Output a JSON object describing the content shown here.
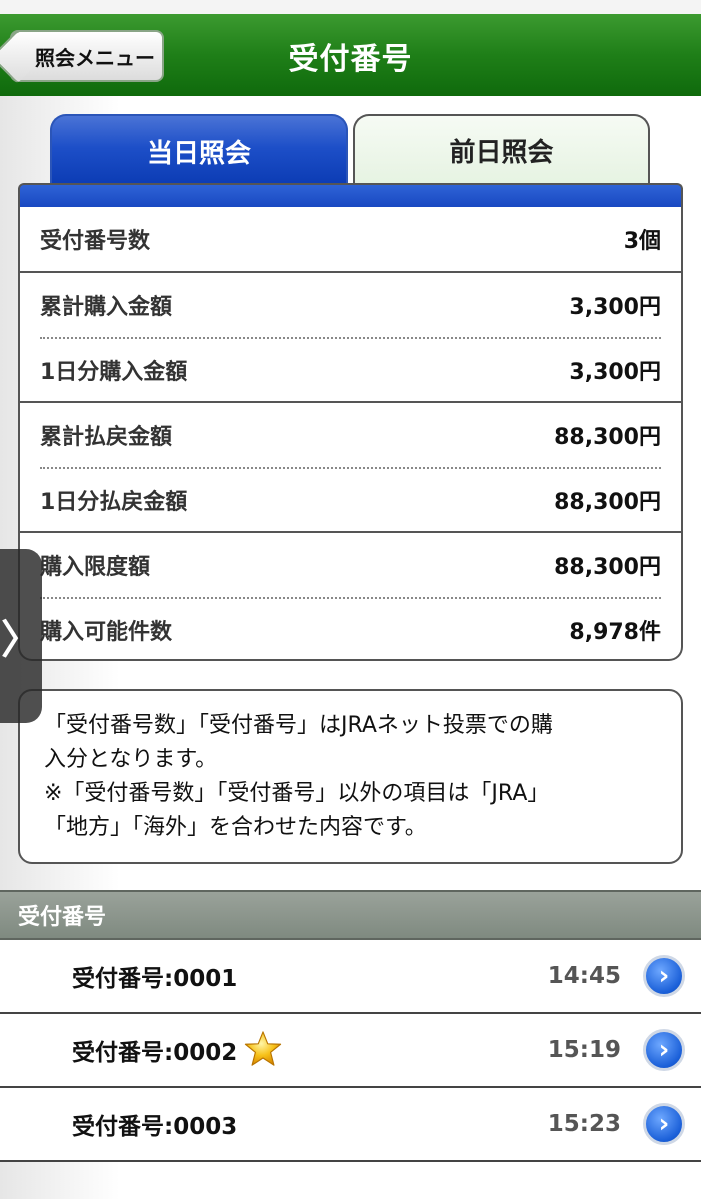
{
  "header": {
    "title": "受付番号",
    "back_label": "照会メニュー"
  },
  "tabs": [
    {
      "label": "当日照会",
      "active": true
    },
    {
      "label": "前日照会",
      "active": false
    }
  ],
  "summary": {
    "groups": [
      [
        {
          "label": "受付番号数",
          "value": "3個"
        }
      ],
      [
        {
          "label": "累計購入金額",
          "value": "3,300円"
        },
        {
          "label": "1日分購入金額",
          "value": "3,300円"
        }
      ],
      [
        {
          "label": "累計払戻金額",
          "value": "88,300円"
        },
        {
          "label": "1日分払戻金額",
          "value": "88,300円"
        }
      ],
      [
        {
          "label": "購入限度額",
          "value": "88,300円"
        },
        {
          "label": "購入可能件数",
          "value": "8,978件"
        }
      ]
    ]
  },
  "note": {
    "line1": "「受付番号数」「受付番号」はJRAネット投票での購",
    "line2": "入分となります。",
    "line3": "※「受付番号数」「受付番号」以外の項目は「JRA」",
    "line4": "「地方」「海外」を合わせた内容です。"
  },
  "side_handle": {
    "glyph": "〉"
  },
  "section": {
    "title": "受付番号"
  },
  "receipts": [
    {
      "number": "受付番号:0001",
      "time": "14:45",
      "starred": false
    },
    {
      "number": "受付番号:0002",
      "time": "15:19",
      "starred": true
    },
    {
      "number": "受付番号:0003",
      "time": "15:23",
      "starred": false
    }
  ],
  "icons": {
    "chevron": "›"
  },
  "colors": {
    "header_green": "#1f7f18",
    "tab_blue": "#1d4fc8",
    "star": "#f5b800"
  }
}
